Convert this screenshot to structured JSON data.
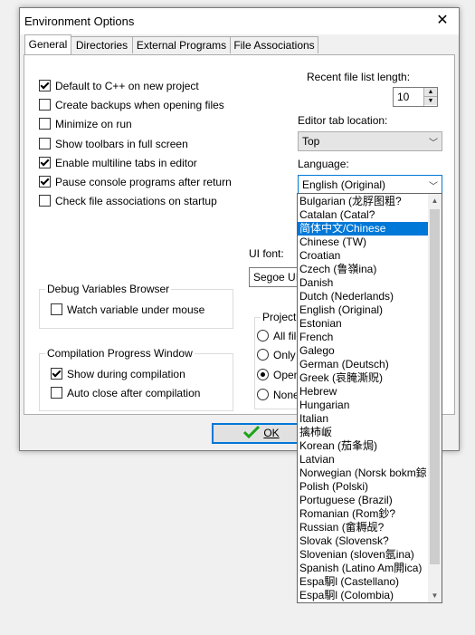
{
  "window": {
    "title": "Environment Options",
    "close_glyph": "✕"
  },
  "tabs": [
    "General",
    "Directories",
    "External Programs",
    "File Associations"
  ],
  "checkboxes": [
    {
      "label": "Default to C++ on new project",
      "checked": true
    },
    {
      "label": "Create backups when opening files",
      "checked": false
    },
    {
      "label": "Minimize on run",
      "checked": false
    },
    {
      "label": "Show toolbars in full screen",
      "checked": false
    },
    {
      "label": "Enable multiline tabs in editor",
      "checked": true
    },
    {
      "label": "Pause console programs after return",
      "checked": true
    },
    {
      "label": "Check file associations on startup",
      "checked": false
    }
  ],
  "recent": {
    "label": "Recent file list length:",
    "value": "10"
  },
  "editor_tab": {
    "label": "Editor tab location:",
    "value": "Top"
  },
  "language": {
    "label": "Language:",
    "value": "English (Original)"
  },
  "ui_font": {
    "label": "UI font:",
    "value": "Segoe UI"
  },
  "debug_group": {
    "title": "Debug Variables Browser",
    "items": [
      {
        "label": "Watch variable under mouse",
        "checked": false
      }
    ]
  },
  "compile_group": {
    "title": "Compilation Progress Window",
    "items": [
      {
        "label": "Show during compilation",
        "checked": true
      },
      {
        "label": "Auto close after compilation",
        "checked": false
      }
    ]
  },
  "project_group": {
    "title": "Project A",
    "options": [
      {
        "label": "All file",
        "selected": false
      },
      {
        "label": "Only f",
        "selected": false
      },
      {
        "label": "Opene",
        "selected": true
      },
      {
        "label": "None",
        "selected": false
      }
    ]
  },
  "buttons": {
    "ok": "OK",
    "ok_icon": "checkmark-icon",
    "ok_icon_color": "#1aa31a"
  },
  "accent_color": "#0078d7",
  "language_list": [
    "Bulgarian (龙脬图粗?",
    "Catalan (Catal?",
    "简体中文/Chinese",
    "Chinese (TW)",
    "Croatian",
    "Czech (鲁嶺ina)",
    "Danish",
    "Dutch (Nederlands)",
    "English (Original)",
    "Estonian",
    "French",
    "Galego",
    "German (Deutsch)",
    "Greek (哀腌澌贶)",
    "Hebrew",
    "Hungarian",
    "Italian",
    "擒柿岅",
    "Korean (茄夆焗)",
    "Latvian",
    "Norwegian (Norsk bokm鍄",
    "Polish (Polski)",
    "Portuguese (Brazil)",
    "Romanian (Rom鈔?",
    "Russian (畲耨觇?",
    "Slovak (Slovensk?",
    "Slovenian (sloven氬ina)",
    "Spanish (Latino Am閞ica)",
    "Espa駉l (Castellano)",
    "Espa駉l (Colombia)"
  ],
  "language_selected_index": 2
}
